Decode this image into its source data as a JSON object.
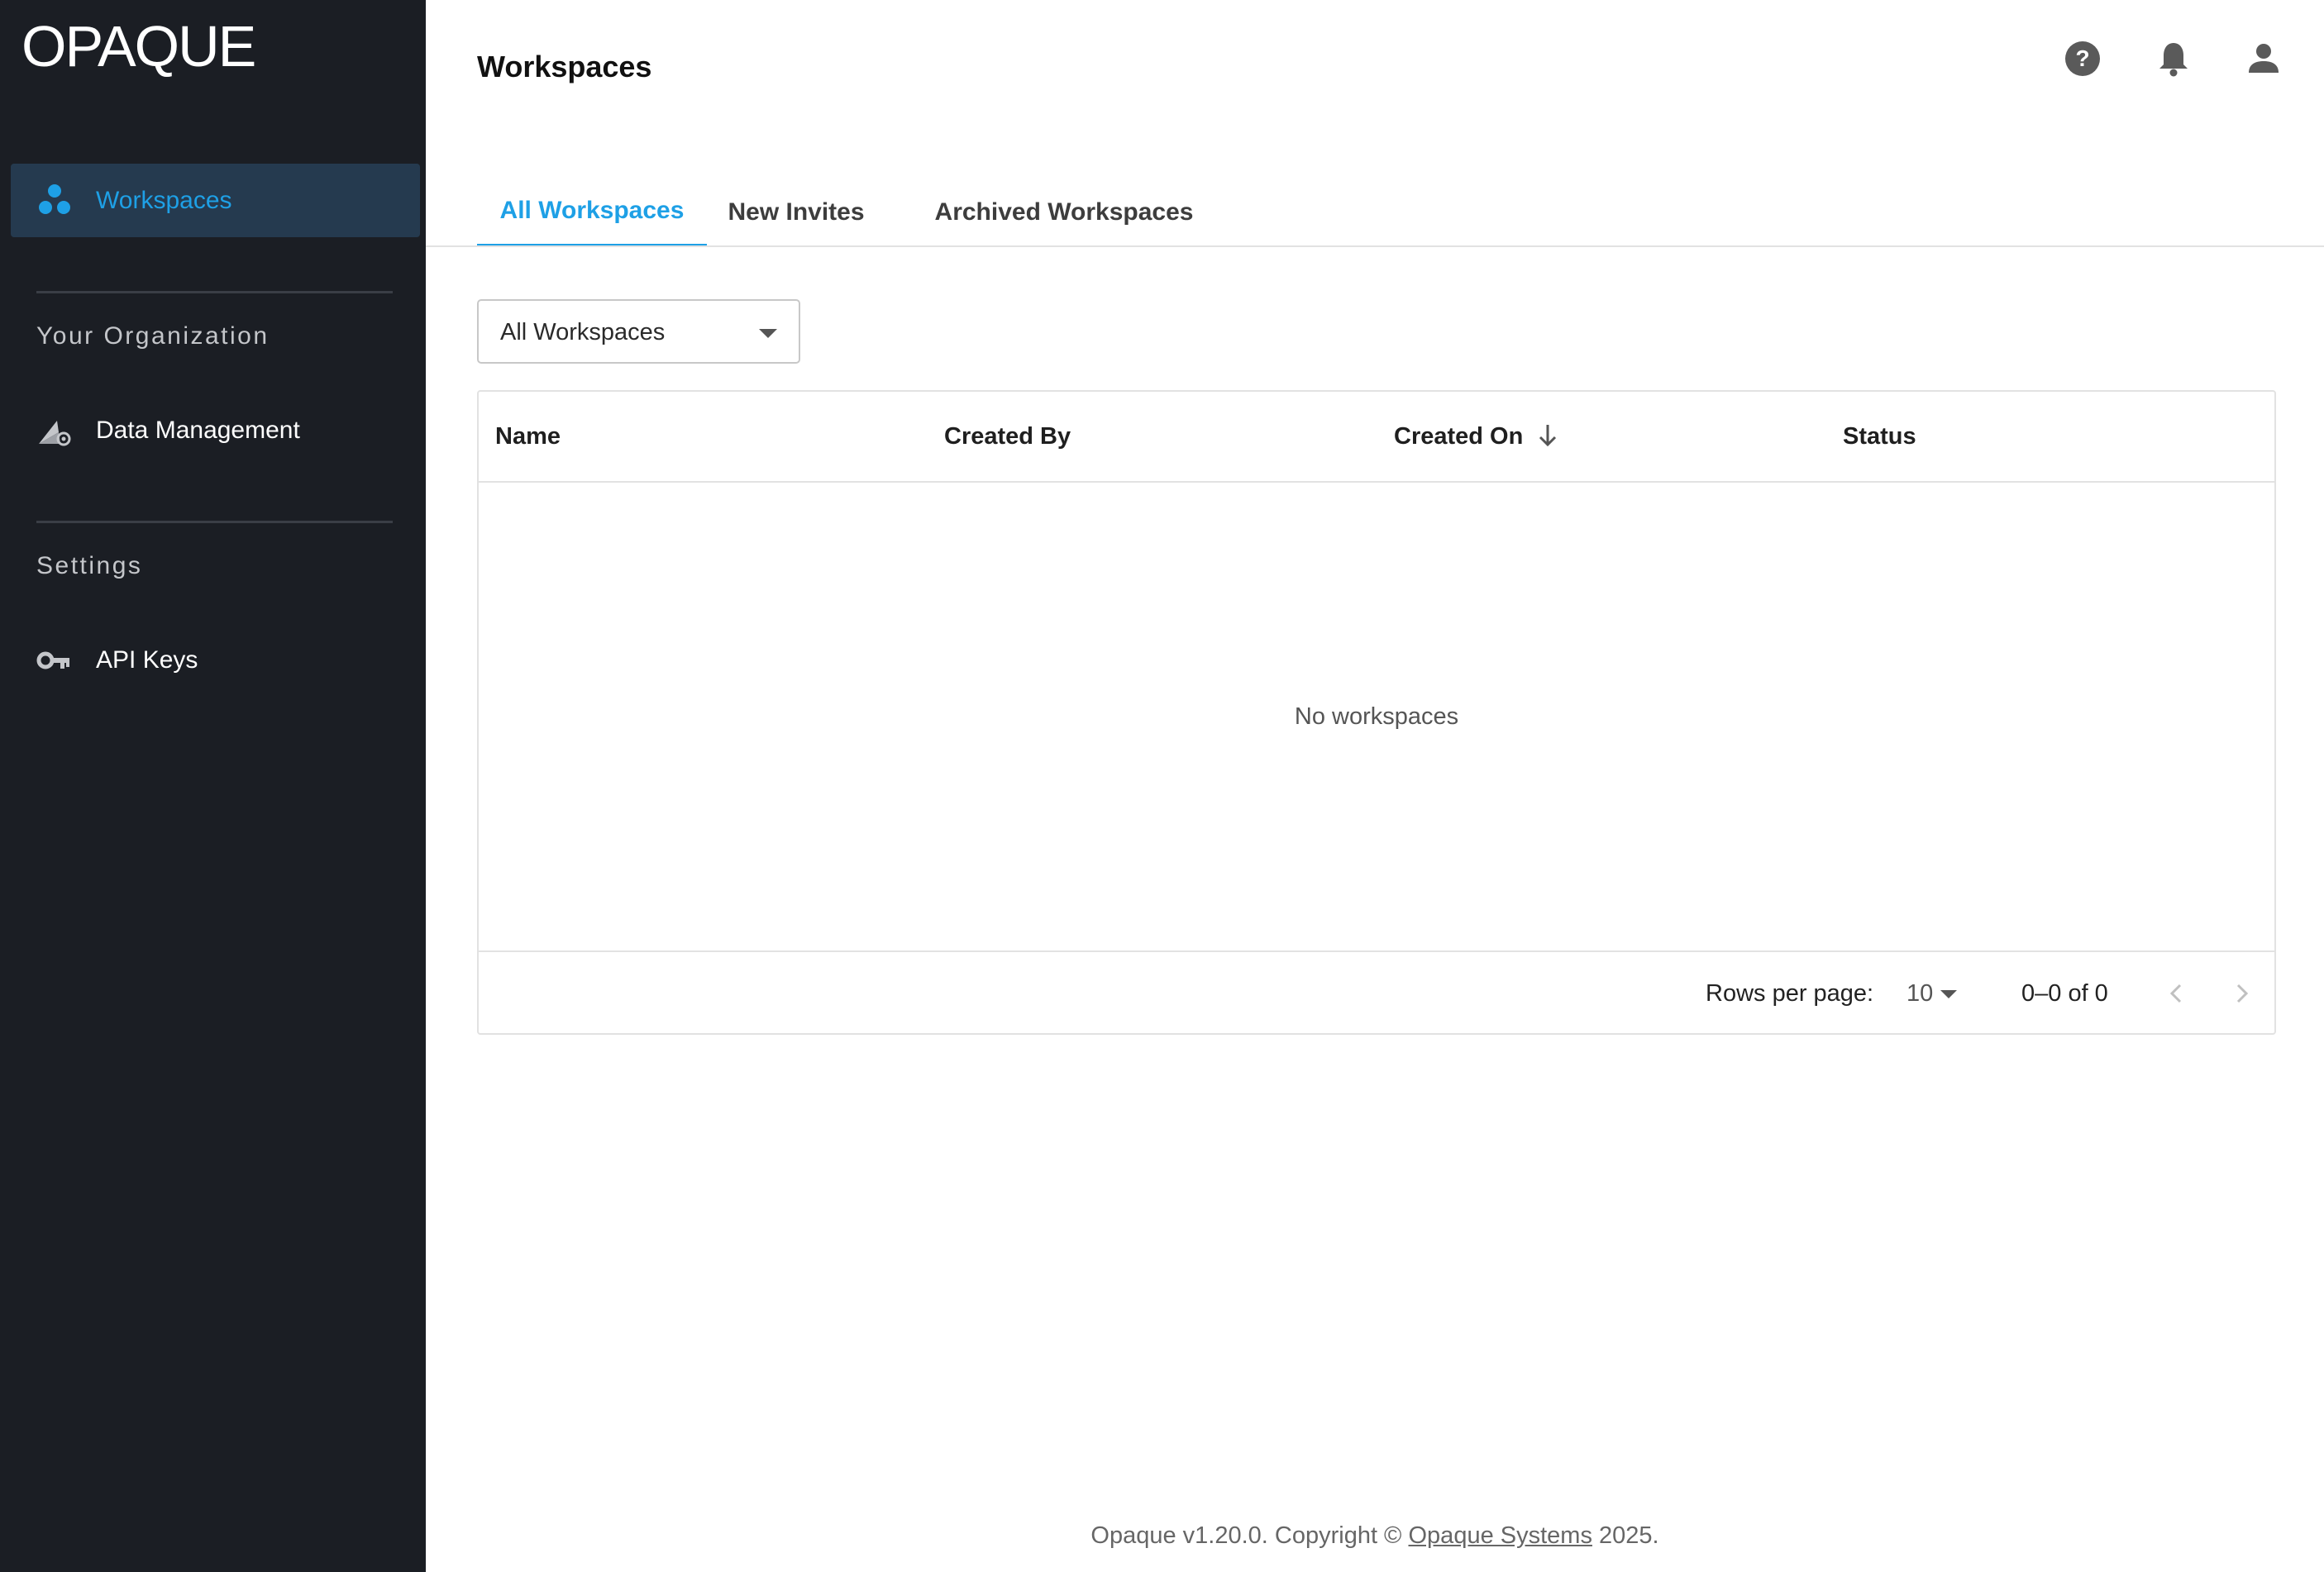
{
  "app": {
    "logo": "OPAQUE"
  },
  "sidebar": {
    "active_item": {
      "label": "Workspaces",
      "icon": "workspaces-dots-icon"
    },
    "sections": [
      {
        "title": "Your Organization",
        "items": [
          {
            "label": "Data Management",
            "icon": "data-management-icon"
          }
        ]
      },
      {
        "title": "Settings",
        "items": [
          {
            "label": "API Keys",
            "icon": "key-icon"
          }
        ]
      }
    ]
  },
  "header": {
    "title": "Workspaces",
    "icons": [
      "help-icon",
      "bell-icon",
      "user-icon"
    ]
  },
  "tabs": [
    {
      "label": "All Workspaces",
      "active": true
    },
    {
      "label": "New Invites",
      "active": false
    },
    {
      "label": "Archived Workspaces",
      "active": false
    }
  ],
  "filter": {
    "selected": "All Workspaces"
  },
  "table": {
    "columns": [
      "Name",
      "Created By",
      "Created On",
      "Status"
    ],
    "sorted_column": "Created On",
    "sort_direction": "descending",
    "empty_message": "No workspaces",
    "pagination": {
      "rows_per_page_label": "Rows per page:",
      "rows_per_page": "10",
      "range": "0–0 of 0"
    }
  },
  "footer": {
    "prefix": "Opaque v1.20.0. Copyright © ",
    "link": "Opaque Systems",
    "suffix": " 2025."
  },
  "colors": {
    "sidebar_bg": "#1b1e24",
    "active_item_bg": "#253a4f",
    "accent": "#1ea0e6"
  }
}
